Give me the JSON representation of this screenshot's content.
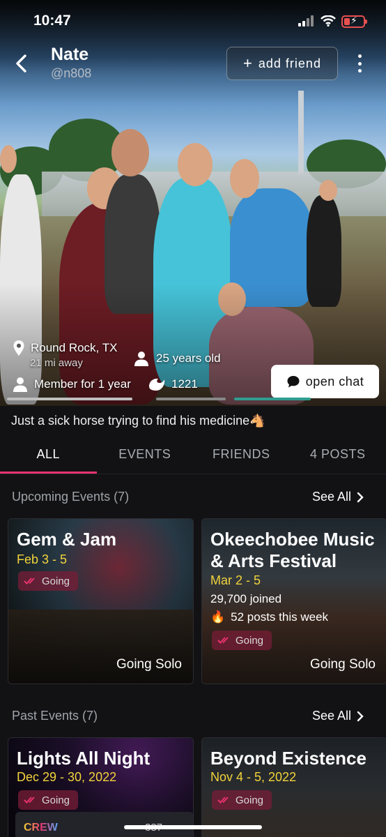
{
  "status_bar": {
    "time": "10:47"
  },
  "header": {
    "name": "Nate",
    "handle": "@n808",
    "add_friend_label": "add friend"
  },
  "profile": {
    "location": "Round Rock, TX",
    "distance": "21 mi away",
    "age": "25 years old",
    "member_since": "Member for 1 year",
    "points": "1221",
    "open_chat_label": "open chat",
    "bio": "Just a sick horse trying to find his medicine🐴"
  },
  "tabs": [
    {
      "label": "ALL",
      "active": true
    },
    {
      "label": "EVENTS"
    },
    {
      "label": "FRIENDS"
    },
    {
      "label": "4 POSTS"
    }
  ],
  "upcoming": {
    "title": "Upcoming Events (7)",
    "see_all": "See All",
    "events": [
      {
        "title": "Gem & Jam",
        "dates": "Feb 3 - 5",
        "badge": "Going",
        "footer": "Going Solo"
      },
      {
        "title": "Okeechobee Music & Arts Festival",
        "dates": "Mar 2 - 5",
        "joined": "29,700 joined",
        "posts": "52 posts this week",
        "badge": "Going",
        "footer": "Going Solo"
      }
    ]
  },
  "past": {
    "title": "Past Events (7)",
    "see_all": "See All",
    "events": [
      {
        "title": "Lights All Night",
        "dates": "Dec 29 - 30, 2022",
        "badge": "Going",
        "crew_label": "CREW",
        "crew_count": "387"
      },
      {
        "title": "Beyond Existence",
        "dates": "Nov 4 - 5, 2022",
        "badge": "Going"
      }
    ]
  },
  "colors": {
    "accent": "#e8336e",
    "date_yellow": "#f2d33b",
    "background": "#121214"
  }
}
